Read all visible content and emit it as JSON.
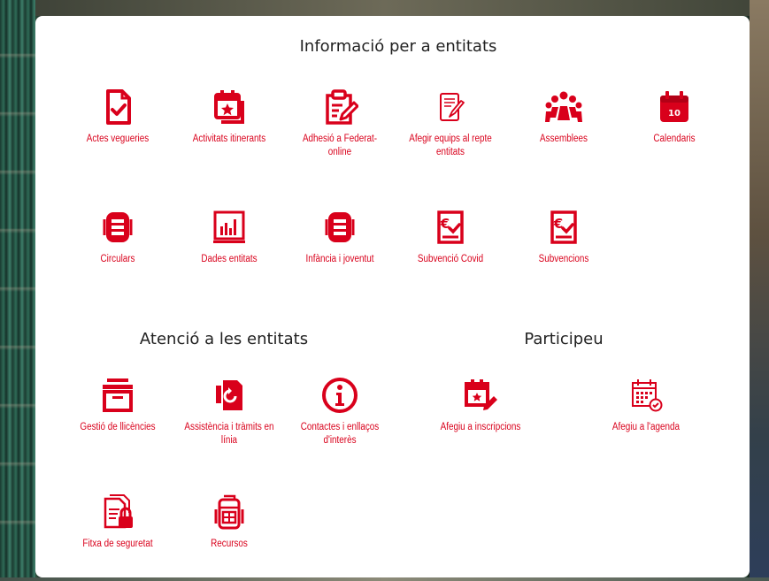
{
  "colors": {
    "accent": "#d9001b",
    "panel": "#ffffff",
    "heading": "#222222"
  },
  "sections": {
    "info": {
      "title": "Informació per a entitats",
      "items": [
        {
          "label": "Actes vegueries",
          "icon": "document-check-icon"
        },
        {
          "label": "Activitats itinerants",
          "icon": "calendar-star-icon"
        },
        {
          "label": "Adhesió a Federat-online",
          "icon": "clipboard-edit-icon"
        },
        {
          "label": "Afegir equips al repte entitats",
          "icon": "paper-pen-icon"
        },
        {
          "label": "Assemblees",
          "icon": "group-people-icon"
        },
        {
          "label": "Calendaris",
          "icon": "calendar-10-icon",
          "badge": "10"
        },
        {
          "label": "Circulars",
          "icon": "document-list-icon"
        },
        {
          "label": "Dades entitats",
          "icon": "bar-chart-icon"
        },
        {
          "label": "Infància i joventut",
          "icon": "document-list-icon"
        },
        {
          "label": "Subvenció Covid",
          "icon": "euro-check-icon"
        },
        {
          "label": "Subvencions",
          "icon": "euro-check-icon"
        }
      ]
    },
    "attention": {
      "title": "Atenció a les entitats",
      "items": [
        {
          "label": "Gestió de llicències",
          "icon": "archive-box-icon"
        },
        {
          "label": "Assistència i tràmits en línia",
          "icon": "support-arrow-icon"
        },
        {
          "label": "Contactes i enllaços d'interès",
          "icon": "info-circle-icon"
        },
        {
          "label": "Fitxa de seguretat",
          "icon": "document-lock-icon"
        },
        {
          "label": "Recursos",
          "icon": "backpack-icon"
        }
      ]
    },
    "participate": {
      "title": "Participeu",
      "items": [
        {
          "label": "Afegiu a inscripcions",
          "icon": "calendar-edit-icon"
        },
        {
          "label": "Afegiu a l'agenda",
          "icon": "calendar-check-icon"
        }
      ]
    }
  }
}
